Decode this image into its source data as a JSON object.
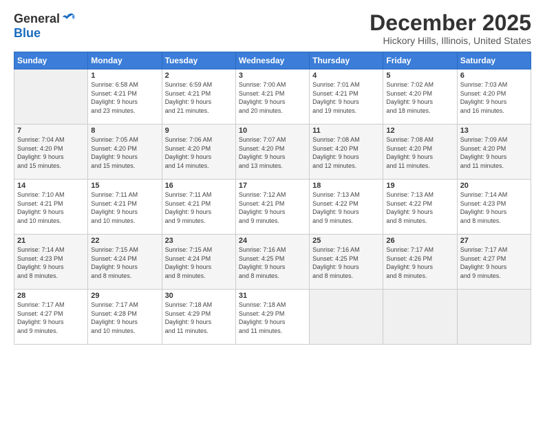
{
  "logo": {
    "general": "General",
    "blue": "Blue"
  },
  "header": {
    "month": "December 2025",
    "location": "Hickory Hills, Illinois, United States"
  },
  "weekdays": [
    "Sunday",
    "Monday",
    "Tuesday",
    "Wednesday",
    "Thursday",
    "Friday",
    "Saturday"
  ],
  "weeks": [
    [
      {
        "day": "",
        "info": ""
      },
      {
        "day": "1",
        "info": "Sunrise: 6:58 AM\nSunset: 4:21 PM\nDaylight: 9 hours\nand 23 minutes."
      },
      {
        "day": "2",
        "info": "Sunrise: 6:59 AM\nSunset: 4:21 PM\nDaylight: 9 hours\nand 21 minutes."
      },
      {
        "day": "3",
        "info": "Sunrise: 7:00 AM\nSunset: 4:21 PM\nDaylight: 9 hours\nand 20 minutes."
      },
      {
        "day": "4",
        "info": "Sunrise: 7:01 AM\nSunset: 4:21 PM\nDaylight: 9 hours\nand 19 minutes."
      },
      {
        "day": "5",
        "info": "Sunrise: 7:02 AM\nSunset: 4:20 PM\nDaylight: 9 hours\nand 18 minutes."
      },
      {
        "day": "6",
        "info": "Sunrise: 7:03 AM\nSunset: 4:20 PM\nDaylight: 9 hours\nand 16 minutes."
      }
    ],
    [
      {
        "day": "7",
        "info": "Sunrise: 7:04 AM\nSunset: 4:20 PM\nDaylight: 9 hours\nand 15 minutes."
      },
      {
        "day": "8",
        "info": "Sunrise: 7:05 AM\nSunset: 4:20 PM\nDaylight: 9 hours\nand 15 minutes."
      },
      {
        "day": "9",
        "info": "Sunrise: 7:06 AM\nSunset: 4:20 PM\nDaylight: 9 hours\nand 14 minutes."
      },
      {
        "day": "10",
        "info": "Sunrise: 7:07 AM\nSunset: 4:20 PM\nDaylight: 9 hours\nand 13 minutes."
      },
      {
        "day": "11",
        "info": "Sunrise: 7:08 AM\nSunset: 4:20 PM\nDaylight: 9 hours\nand 12 minutes."
      },
      {
        "day": "12",
        "info": "Sunrise: 7:08 AM\nSunset: 4:20 PM\nDaylight: 9 hours\nand 11 minutes."
      },
      {
        "day": "13",
        "info": "Sunrise: 7:09 AM\nSunset: 4:20 PM\nDaylight: 9 hours\nand 11 minutes."
      }
    ],
    [
      {
        "day": "14",
        "info": "Sunrise: 7:10 AM\nSunset: 4:21 PM\nDaylight: 9 hours\nand 10 minutes."
      },
      {
        "day": "15",
        "info": "Sunrise: 7:11 AM\nSunset: 4:21 PM\nDaylight: 9 hours\nand 10 minutes."
      },
      {
        "day": "16",
        "info": "Sunrise: 7:11 AM\nSunset: 4:21 PM\nDaylight: 9 hours\nand 9 minutes."
      },
      {
        "day": "17",
        "info": "Sunrise: 7:12 AM\nSunset: 4:21 PM\nDaylight: 9 hours\nand 9 minutes."
      },
      {
        "day": "18",
        "info": "Sunrise: 7:13 AM\nSunset: 4:22 PM\nDaylight: 9 hours\nand 9 minutes."
      },
      {
        "day": "19",
        "info": "Sunrise: 7:13 AM\nSunset: 4:22 PM\nDaylight: 9 hours\nand 8 minutes."
      },
      {
        "day": "20",
        "info": "Sunrise: 7:14 AM\nSunset: 4:23 PM\nDaylight: 9 hours\nand 8 minutes."
      }
    ],
    [
      {
        "day": "21",
        "info": "Sunrise: 7:14 AM\nSunset: 4:23 PM\nDaylight: 9 hours\nand 8 minutes."
      },
      {
        "day": "22",
        "info": "Sunrise: 7:15 AM\nSunset: 4:24 PM\nDaylight: 9 hours\nand 8 minutes."
      },
      {
        "day": "23",
        "info": "Sunrise: 7:15 AM\nSunset: 4:24 PM\nDaylight: 9 hours\nand 8 minutes."
      },
      {
        "day": "24",
        "info": "Sunrise: 7:16 AM\nSunset: 4:25 PM\nDaylight: 9 hours\nand 8 minutes."
      },
      {
        "day": "25",
        "info": "Sunrise: 7:16 AM\nSunset: 4:25 PM\nDaylight: 9 hours\nand 8 minutes."
      },
      {
        "day": "26",
        "info": "Sunrise: 7:17 AM\nSunset: 4:26 PM\nDaylight: 9 hours\nand 8 minutes."
      },
      {
        "day": "27",
        "info": "Sunrise: 7:17 AM\nSunset: 4:27 PM\nDaylight: 9 hours\nand 9 minutes."
      }
    ],
    [
      {
        "day": "28",
        "info": "Sunrise: 7:17 AM\nSunset: 4:27 PM\nDaylight: 9 hours\nand 9 minutes."
      },
      {
        "day": "29",
        "info": "Sunrise: 7:17 AM\nSunset: 4:28 PM\nDaylight: 9 hours\nand 10 minutes."
      },
      {
        "day": "30",
        "info": "Sunrise: 7:18 AM\nSunset: 4:29 PM\nDaylight: 9 hours\nand 11 minutes."
      },
      {
        "day": "31",
        "info": "Sunrise: 7:18 AM\nSunset: 4:29 PM\nDaylight: 9 hours\nand 11 minutes."
      },
      {
        "day": "",
        "info": ""
      },
      {
        "day": "",
        "info": ""
      },
      {
        "day": "",
        "info": ""
      }
    ]
  ]
}
